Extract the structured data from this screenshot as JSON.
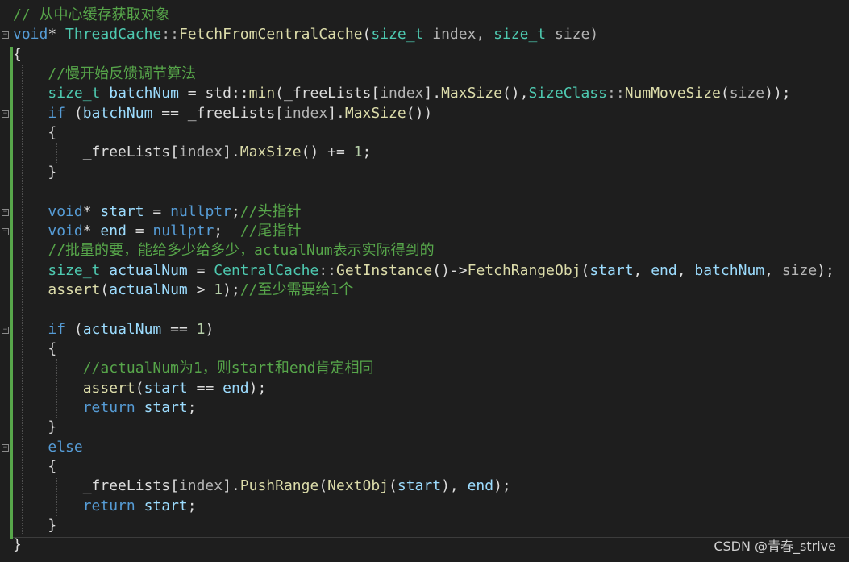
{
  "colors": {
    "background": "#1e1e1e",
    "comment": "#57a64a",
    "keyword": "#569cd6",
    "type": "#4ec9b0",
    "function": "#dcdcaa",
    "variable": "#9cdcfe",
    "number": "#b5cea8",
    "plain": "#dcdcdc",
    "member": "#b4b4b4"
  },
  "code": {
    "lines": [
      [
        {
          "t": "// 从中心缓存获取对象",
          "c": "comment"
        }
      ],
      [
        {
          "t": "void",
          "c": "keyword"
        },
        {
          "t": "* ",
          "c": "plain"
        },
        {
          "t": "ThreadCache",
          "c": "type"
        },
        {
          "t": "::",
          "c": "member"
        },
        {
          "t": "FetchFromCentralCache",
          "c": "function"
        },
        {
          "t": "(",
          "c": "plain"
        },
        {
          "t": "size_t",
          "c": "type"
        },
        {
          "t": " index, ",
          "c": "member"
        },
        {
          "t": "size_t",
          "c": "type"
        },
        {
          "t": " size)",
          "c": "member"
        }
      ],
      [
        {
          "t": "{",
          "c": "plain"
        }
      ],
      [
        {
          "t": "    ",
          "c": "plain"
        },
        {
          "t": "//慢开始反馈调节算法",
          "c": "comment"
        }
      ],
      [
        {
          "t": "    ",
          "c": "plain"
        },
        {
          "t": "size_t",
          "c": "type"
        },
        {
          "t": " ",
          "c": "plain"
        },
        {
          "t": "batchNum",
          "c": "variable"
        },
        {
          "t": " = std::",
          "c": "plain"
        },
        {
          "t": "min",
          "c": "function"
        },
        {
          "t": "(_freeLists[",
          "c": "plain"
        },
        {
          "t": "index",
          "c": "member"
        },
        {
          "t": "].",
          "c": "plain"
        },
        {
          "t": "MaxSize",
          "c": "function"
        },
        {
          "t": "(),",
          "c": "plain"
        },
        {
          "t": "SizeClass",
          "c": "type"
        },
        {
          "t": "::",
          "c": "member"
        },
        {
          "t": "NumMoveSize",
          "c": "function"
        },
        {
          "t": "(",
          "c": "plain"
        },
        {
          "t": "size",
          "c": "member"
        },
        {
          "t": "));",
          "c": "plain"
        }
      ],
      [
        {
          "t": "    ",
          "c": "plain"
        },
        {
          "t": "if",
          "c": "keyword"
        },
        {
          "t": " (",
          "c": "plain"
        },
        {
          "t": "batchNum",
          "c": "variable"
        },
        {
          "t": " == _freeLists[",
          "c": "plain"
        },
        {
          "t": "index",
          "c": "member"
        },
        {
          "t": "].",
          "c": "plain"
        },
        {
          "t": "MaxSize",
          "c": "function"
        },
        {
          "t": "())",
          "c": "plain"
        }
      ],
      [
        {
          "t": "    {",
          "c": "plain"
        }
      ],
      [
        {
          "t": "        _freeLists[",
          "c": "plain"
        },
        {
          "t": "index",
          "c": "member"
        },
        {
          "t": "].",
          "c": "plain"
        },
        {
          "t": "MaxSize",
          "c": "function"
        },
        {
          "t": "() += ",
          "c": "plain"
        },
        {
          "t": "1",
          "c": "number"
        },
        {
          "t": ";",
          "c": "plain"
        }
      ],
      [
        {
          "t": "    }",
          "c": "plain"
        }
      ],
      [],
      [
        {
          "t": "    ",
          "c": "plain"
        },
        {
          "t": "void",
          "c": "keyword"
        },
        {
          "t": "* ",
          "c": "plain"
        },
        {
          "t": "start",
          "c": "variable"
        },
        {
          "t": " = ",
          "c": "plain"
        },
        {
          "t": "nullptr",
          "c": "keyword"
        },
        {
          "t": ";",
          "c": "plain"
        },
        {
          "t": "//头指针",
          "c": "comment"
        }
      ],
      [
        {
          "t": "    ",
          "c": "plain"
        },
        {
          "t": "void",
          "c": "keyword"
        },
        {
          "t": "* ",
          "c": "plain"
        },
        {
          "t": "end",
          "c": "variable"
        },
        {
          "t": " = ",
          "c": "plain"
        },
        {
          "t": "nullptr",
          "c": "keyword"
        },
        {
          "t": ";  ",
          "c": "plain"
        },
        {
          "t": "//尾指针",
          "c": "comment"
        }
      ],
      [
        {
          "t": "    ",
          "c": "plain"
        },
        {
          "t": "//批量的要，能给多少给多少，actualNum表示实际得到的",
          "c": "comment"
        }
      ],
      [
        {
          "t": "    ",
          "c": "plain"
        },
        {
          "t": "size_t",
          "c": "type"
        },
        {
          "t": " ",
          "c": "plain"
        },
        {
          "t": "actualNum",
          "c": "variable"
        },
        {
          "t": " = ",
          "c": "plain"
        },
        {
          "t": "CentralCache",
          "c": "type"
        },
        {
          "t": "::",
          "c": "member"
        },
        {
          "t": "GetInstance",
          "c": "function"
        },
        {
          "t": "()->",
          "c": "plain"
        },
        {
          "t": "FetchRangeObj",
          "c": "function"
        },
        {
          "t": "(",
          "c": "plain"
        },
        {
          "t": "start",
          "c": "variable"
        },
        {
          "t": ", ",
          "c": "plain"
        },
        {
          "t": "end",
          "c": "variable"
        },
        {
          "t": ", ",
          "c": "plain"
        },
        {
          "t": "batchNum",
          "c": "variable"
        },
        {
          "t": ", ",
          "c": "plain"
        },
        {
          "t": "size",
          "c": "member"
        },
        {
          "t": ");",
          "c": "plain"
        }
      ],
      [
        {
          "t": "    ",
          "c": "plain"
        },
        {
          "t": "assert",
          "c": "function"
        },
        {
          "t": "(",
          "c": "plain"
        },
        {
          "t": "actualNum",
          "c": "variable"
        },
        {
          "t": " > ",
          "c": "plain"
        },
        {
          "t": "1",
          "c": "number"
        },
        {
          "t": ");",
          "c": "plain"
        },
        {
          "t": "//至少需要给1个",
          "c": "comment"
        }
      ],
      [],
      [
        {
          "t": "    ",
          "c": "plain"
        },
        {
          "t": "if",
          "c": "keyword"
        },
        {
          "t": " (",
          "c": "plain"
        },
        {
          "t": "actualNum",
          "c": "variable"
        },
        {
          "t": " == ",
          "c": "plain"
        },
        {
          "t": "1",
          "c": "number"
        },
        {
          "t": ")",
          "c": "plain"
        }
      ],
      [
        {
          "t": "    {",
          "c": "plain"
        }
      ],
      [
        {
          "t": "        ",
          "c": "plain"
        },
        {
          "t": "//actualNum为1，则start和end肯定相同",
          "c": "comment"
        }
      ],
      [
        {
          "t": "        ",
          "c": "plain"
        },
        {
          "t": "assert",
          "c": "function"
        },
        {
          "t": "(",
          "c": "plain"
        },
        {
          "t": "start",
          "c": "variable"
        },
        {
          "t": " == ",
          "c": "plain"
        },
        {
          "t": "end",
          "c": "variable"
        },
        {
          "t": ");",
          "c": "plain"
        }
      ],
      [
        {
          "t": "        ",
          "c": "plain"
        },
        {
          "t": "return",
          "c": "keyword"
        },
        {
          "t": " ",
          "c": "plain"
        },
        {
          "t": "start",
          "c": "variable"
        },
        {
          "t": ";",
          "c": "plain"
        }
      ],
      [
        {
          "t": "    }",
          "c": "plain"
        }
      ],
      [
        {
          "t": "    ",
          "c": "plain"
        },
        {
          "t": "else",
          "c": "keyword"
        }
      ],
      [
        {
          "t": "    {",
          "c": "plain"
        }
      ],
      [
        {
          "t": "        _freeLists[",
          "c": "plain"
        },
        {
          "t": "index",
          "c": "member"
        },
        {
          "t": "].",
          "c": "plain"
        },
        {
          "t": "PushRange",
          "c": "function"
        },
        {
          "t": "(",
          "c": "plain"
        },
        {
          "t": "NextObj",
          "c": "function"
        },
        {
          "t": "(",
          "c": "plain"
        },
        {
          "t": "start",
          "c": "variable"
        },
        {
          "t": "), ",
          "c": "plain"
        },
        {
          "t": "end",
          "c": "variable"
        },
        {
          "t": ");",
          "c": "plain"
        }
      ],
      [
        {
          "t": "        ",
          "c": "plain"
        },
        {
          "t": "return",
          "c": "keyword"
        },
        {
          "t": " ",
          "c": "plain"
        },
        {
          "t": "start",
          "c": "variable"
        },
        {
          "t": ";",
          "c": "plain"
        }
      ],
      [
        {
          "t": "    }",
          "c": "plain"
        }
      ],
      [
        {
          "t": "}",
          "c": "plain"
        }
      ]
    ],
    "fold_lines": [
      1,
      5,
      10,
      11,
      16,
      22
    ]
  },
  "watermark": "CSDN @青春_strive"
}
